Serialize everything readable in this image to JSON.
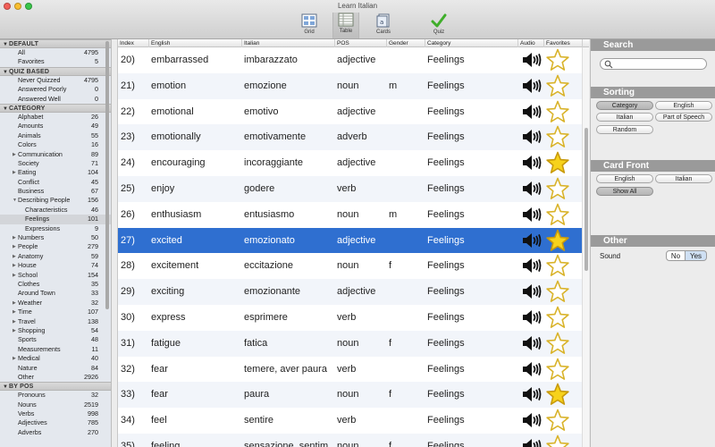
{
  "window": {
    "title": "Learn Italian"
  },
  "toolbar": {
    "buttons": [
      {
        "label": "Grid",
        "icon": "grid-icon"
      },
      {
        "label": "Table",
        "icon": "table-icon",
        "selected": true
      },
      {
        "label": "Cards",
        "icon": "cards-icon"
      },
      {
        "label": "Quiz",
        "icon": "quiz-checkmark-icon"
      }
    ]
  },
  "sidebar": {
    "sections": [
      {
        "title": "DEFAULT",
        "items": [
          {
            "label": "All",
            "count": "4795"
          },
          {
            "label": "Favorites",
            "count": "5"
          }
        ]
      },
      {
        "title": "QUIZ BASED",
        "items": [
          {
            "label": "Never Quizzed",
            "count": "4795"
          },
          {
            "label": "Answered Poorly",
            "count": "0"
          },
          {
            "label": "Answered Well",
            "count": "0"
          }
        ]
      },
      {
        "title": "CATEGORY",
        "items": [
          {
            "label": "Alphabet",
            "count": "26"
          },
          {
            "label": "Amounts",
            "count": "49"
          },
          {
            "label": "Animals",
            "count": "55"
          },
          {
            "label": "Colors",
            "count": "16"
          },
          {
            "label": "Communication",
            "count": "89",
            "expandable": true
          },
          {
            "label": "Society",
            "count": "71"
          },
          {
            "label": "Eating",
            "count": "104",
            "expandable": true
          },
          {
            "label": "Conflict",
            "count": "45"
          },
          {
            "label": "Business",
            "count": "67"
          },
          {
            "label": "Describing People",
            "count": "156",
            "expanded": true
          },
          {
            "label": "Characteristics",
            "count": "46",
            "indent": 2
          },
          {
            "label": "Feelings",
            "count": "101",
            "indent": 2,
            "selected": true
          },
          {
            "label": "Expressions",
            "count": "9",
            "indent": 2
          },
          {
            "label": "Numbers",
            "count": "50",
            "expandable": true
          },
          {
            "label": "People",
            "count": "279",
            "expandable": true
          },
          {
            "label": "Anatomy",
            "count": "59",
            "expandable": true
          },
          {
            "label": "House",
            "count": "74",
            "expandable": true
          },
          {
            "label": "School",
            "count": "154",
            "expandable": true
          },
          {
            "label": "Clothes",
            "count": "35"
          },
          {
            "label": "Around Town",
            "count": "33"
          },
          {
            "label": "Weather",
            "count": "32",
            "expandable": true
          },
          {
            "label": "Time",
            "count": "107",
            "expandable": true
          },
          {
            "label": "Travel",
            "count": "138",
            "expandable": true
          },
          {
            "label": "Shopping",
            "count": "54",
            "expandable": true
          },
          {
            "label": "Sports",
            "count": "48"
          },
          {
            "label": "Measurements",
            "count": "11"
          },
          {
            "label": "Medical",
            "count": "40",
            "expandable": true
          },
          {
            "label": "Nature",
            "count": "84"
          },
          {
            "label": "Other",
            "count": "2926"
          }
        ]
      },
      {
        "title": "BY POS",
        "items": [
          {
            "label": "Pronouns",
            "count": "32"
          },
          {
            "label": "Nouns",
            "count": "2519"
          },
          {
            "label": "Verbs",
            "count": "998"
          },
          {
            "label": "Adjectives",
            "count": "785"
          },
          {
            "label": "Adverbs",
            "count": "270"
          }
        ]
      }
    ]
  },
  "table": {
    "columns": [
      "Index",
      "English",
      "Italian",
      "POS",
      "Gender",
      "Category",
      "Audio",
      "Favorites"
    ],
    "rows": [
      {
        "index": "20)",
        "english": "embarrassed",
        "italian": "imbarazzato",
        "pos": "adjective",
        "gender": "",
        "category": "Feelings",
        "favorite": false
      },
      {
        "index": "21)",
        "english": "emotion",
        "italian": "emozione",
        "pos": "noun",
        "gender": "m",
        "category": "Feelings",
        "favorite": false
      },
      {
        "index": "22)",
        "english": "emotional",
        "italian": "emotivo",
        "pos": "adjective",
        "gender": "",
        "category": "Feelings",
        "favorite": false
      },
      {
        "index": "23)",
        "english": "emotionally",
        "italian": "emotivamente",
        "pos": "adverb",
        "gender": "",
        "category": "Feelings",
        "favorite": false
      },
      {
        "index": "24)",
        "english": "encouraging",
        "italian": "incoraggiante",
        "pos": "adjective",
        "gender": "",
        "category": "Feelings",
        "favorite": true
      },
      {
        "index": "25)",
        "english": "enjoy",
        "italian": "godere",
        "pos": "verb",
        "gender": "",
        "category": "Feelings",
        "favorite": false
      },
      {
        "index": "26)",
        "english": "enthusiasm",
        "italian": "entusiasmo",
        "pos": "noun",
        "gender": "m",
        "category": "Feelings",
        "favorite": false
      },
      {
        "index": "27)",
        "english": "excited",
        "italian": "emozionato",
        "pos": "adjective",
        "gender": "",
        "category": "Feelings",
        "favorite": true,
        "selected": true
      },
      {
        "index": "28)",
        "english": "excitement",
        "italian": "eccitazione",
        "pos": "noun",
        "gender": "f",
        "category": "Feelings",
        "favorite": false
      },
      {
        "index": "29)",
        "english": "exciting",
        "italian": "emozionante",
        "pos": "adjective",
        "gender": "",
        "category": "Feelings",
        "favorite": false
      },
      {
        "index": "30)",
        "english": "express",
        "italian": "esprimere",
        "pos": "verb",
        "gender": "",
        "category": "Feelings",
        "favorite": false
      },
      {
        "index": "31)",
        "english": "fatigue",
        "italian": "fatica",
        "pos": "noun",
        "gender": "f",
        "category": "Feelings",
        "favorite": false
      },
      {
        "index": "32)",
        "english": "fear",
        "italian": "temere, aver paura",
        "pos": "verb",
        "gender": "",
        "category": "Feelings",
        "favorite": false
      },
      {
        "index": "33)",
        "english": "fear",
        "italian": "paura",
        "pos": "noun",
        "gender": "f",
        "category": "Feelings",
        "favorite": true
      },
      {
        "index": "34)",
        "english": "feel",
        "italian": "sentire",
        "pos": "verb",
        "gender": "",
        "category": "Feelings",
        "favorite": false
      },
      {
        "index": "35)",
        "english": "feeling",
        "italian": "sensazione, sentim...",
        "pos": "noun",
        "gender": "f",
        "category": "Feelings",
        "favorite": false
      }
    ]
  },
  "right_panel": {
    "search": {
      "title": "Search",
      "placeholder": ""
    },
    "sorting": {
      "title": "Sorting",
      "options": [
        "Category",
        "English",
        "Italian",
        "Part of Speech",
        "Random"
      ],
      "selected": "Category"
    },
    "card_front": {
      "title": "Card Front",
      "options": [
        "English",
        "Italian",
        "Show All"
      ],
      "selected": "Show All"
    },
    "other": {
      "title": "Other",
      "sound_label": "Sound",
      "no_label": "No",
      "yes_label": "Yes",
      "sound": "Yes"
    }
  },
  "colors": {
    "selection": "#2f6fd0",
    "star_fill": "#f7d21b",
    "panel_header": "#9a9a9a"
  }
}
